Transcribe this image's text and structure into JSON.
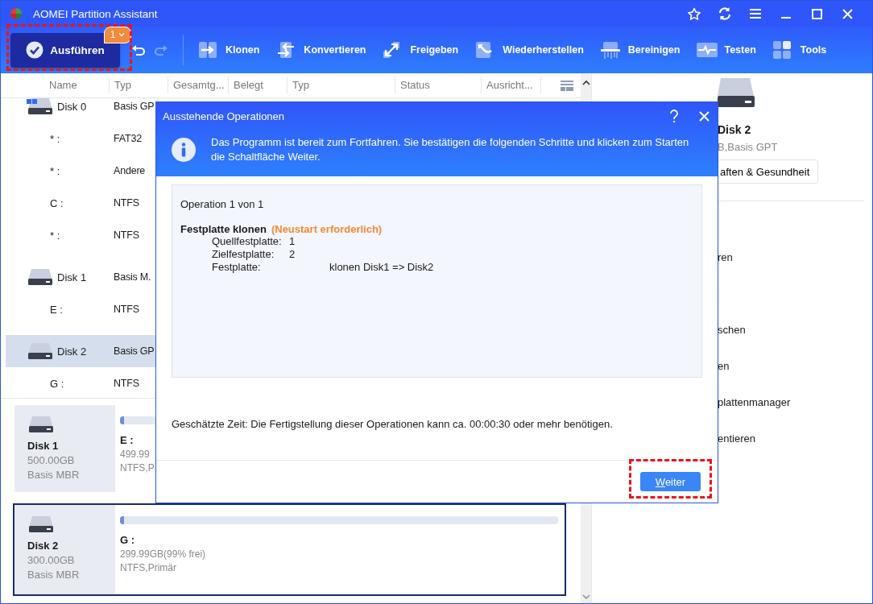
{
  "window": {
    "title": "AOMEI Partition Assistant"
  },
  "toolbar": {
    "execute": {
      "label": "Ausführen",
      "badge": "1",
      "highlighted": true
    },
    "undo": {
      "disabled": false
    },
    "redo": {
      "disabled": true
    },
    "tools": [
      {
        "kind": "clone",
        "label": "Klonen"
      },
      {
        "kind": "convert",
        "label": "Konvertieren"
      },
      {
        "kind": "share",
        "label": "Freigeben"
      },
      {
        "kind": "recover",
        "label": "Wiederherstellen"
      },
      {
        "kind": "clean",
        "label": "Bereinigen"
      },
      {
        "kind": "test",
        "label": "Testen"
      },
      {
        "kind": "tools",
        "label": "Tools"
      }
    ]
  },
  "table": {
    "columns": [
      "Name",
      "Typ",
      "Gesamtg...",
      "Belegt",
      "Typ",
      "Status",
      "Ausricht..."
    ],
    "disks": [
      {
        "name": "Disk 0",
        "type": "Basis GP",
        "system": true,
        "selected": false,
        "children": [
          {
            "name": "* :",
            "type": "FAT32"
          },
          {
            "name": "* :",
            "type": "Andere"
          },
          {
            "name": "C :",
            "type": "NTFS"
          },
          {
            "name": "* :",
            "type": "NTFS"
          }
        ]
      },
      {
        "name": "Disk 1",
        "type": "Basis M.",
        "system": false,
        "selected": false,
        "children": [
          {
            "name": "E :",
            "type": "NTFS"
          }
        ]
      },
      {
        "name": "Disk 2",
        "type": "Basis GP",
        "system": false,
        "selected": true,
        "children": [
          {
            "name": "G :",
            "type": "NTFS"
          }
        ]
      }
    ]
  },
  "disk_cards": [
    {
      "name": "Disk 1",
      "size": "500.00GB",
      "style": "Basis MBR",
      "selected": false,
      "partitions": [
        {
          "label": "E :",
          "usage": "499.99",
          "info": "NTFS,P",
          "level": 0.01
        }
      ]
    },
    {
      "name": "Disk 2",
      "size": "300.00GB",
      "style": "Basis MBR",
      "selected": true,
      "partitions": [
        {
          "label": "G :",
          "usage": "299.99GB(99% frei)",
          "info": "NTFS,Primär",
          "level": 0.01
        }
      ]
    }
  ],
  "right_panel": {
    "disk_name": "Disk 2",
    "disk_info": "B,Basis GPT",
    "properties_button": "aften & Gesundheit",
    "menu_items": [
      "ren",
      "schen",
      "en",
      "plattenmanager",
      "entieren"
    ]
  },
  "dialog": {
    "title": "Ausstehende Operationen",
    "info": "Das Programm ist bereit zum Fortfahren. Sie bestätigen die folgenden Schritte und klicken zum Starten die Schaltfläche Weiter.",
    "operation_header": "Operation 1 von 1",
    "operation": {
      "title": "Festplatte klonen",
      "note": "(Neustart erforderlich)",
      "details": [
        {
          "label": "Quellfestplatte:",
          "value": "1"
        },
        {
          "label": "Zielfestplatte:",
          "value": "2"
        },
        {
          "label": "Festplatte:",
          "value": "klonen Disk1 => Disk2"
        }
      ]
    },
    "estimate": "Geschätzte Zeit: Die Fertigstellung dieser Operationen kann ca. 00:00:30 oder mehr benötigen.",
    "button": {
      "mnemonic": "W",
      "rest": "eiter",
      "highlighted": true
    }
  }
}
